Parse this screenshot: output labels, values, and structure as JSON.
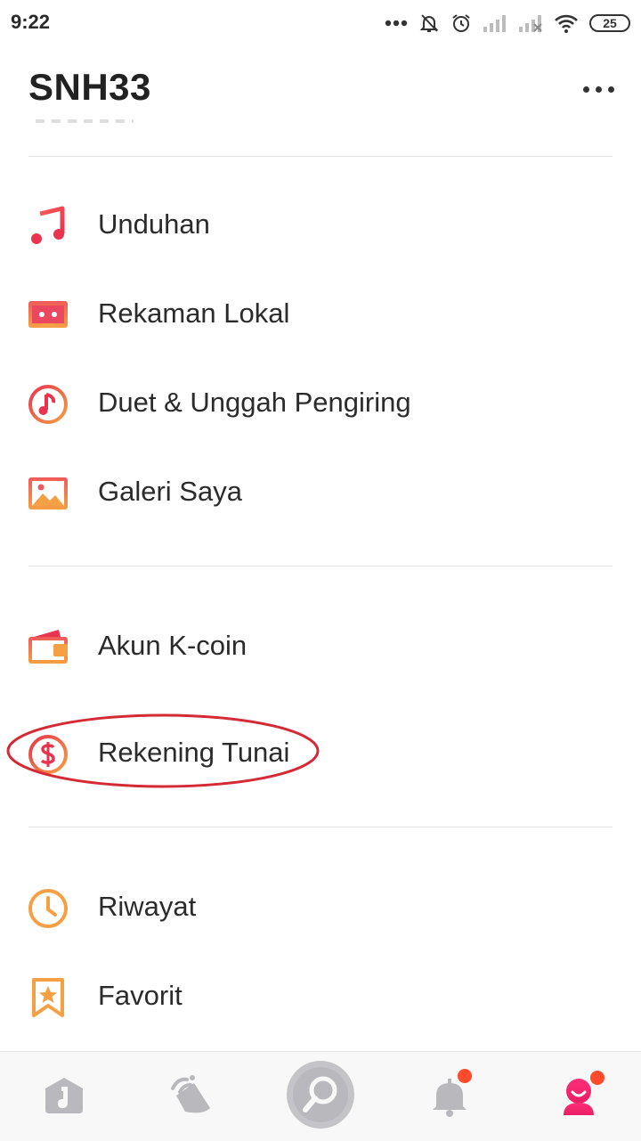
{
  "status_bar": {
    "time": "9:22",
    "battery": "25"
  },
  "header": {
    "title": "SNH33"
  },
  "menu": {
    "group1": [
      {
        "label": "Unduhan",
        "icon": "music-note-icon"
      },
      {
        "label": "Rekaman Lokal",
        "icon": "cassette-icon"
      },
      {
        "label": "Duet & Unggah Pengiring",
        "icon": "music-circle-icon"
      },
      {
        "label": "Galeri Saya",
        "icon": "gallery-icon"
      }
    ],
    "group2": [
      {
        "label": "Akun K-coin",
        "icon": "wallet-icon"
      },
      {
        "label": "Rekening Tunai",
        "icon": "dollar-circle-icon"
      }
    ],
    "group3": [
      {
        "label": "Riwayat",
        "icon": "clock-icon"
      },
      {
        "label": "Favorit",
        "icon": "bookmark-star-icon"
      }
    ]
  },
  "bottom_nav": [
    {
      "name": "home",
      "icon": "home-tab-icon"
    },
    {
      "name": "discover",
      "icon": "feed-tab-icon"
    },
    {
      "name": "sing",
      "icon": "mic-tab-icon"
    },
    {
      "name": "notifications",
      "icon": "bell-tab-icon",
      "badge": true
    },
    {
      "name": "profile",
      "icon": "profile-tab-icon",
      "badge": true
    }
  ],
  "colors": {
    "accent_red": "#e8344e",
    "accent_orange": "#f5a044",
    "highlight": "#d42a35",
    "nav_inactive": "#b9b9bd",
    "nav_active": "#f0297a"
  }
}
